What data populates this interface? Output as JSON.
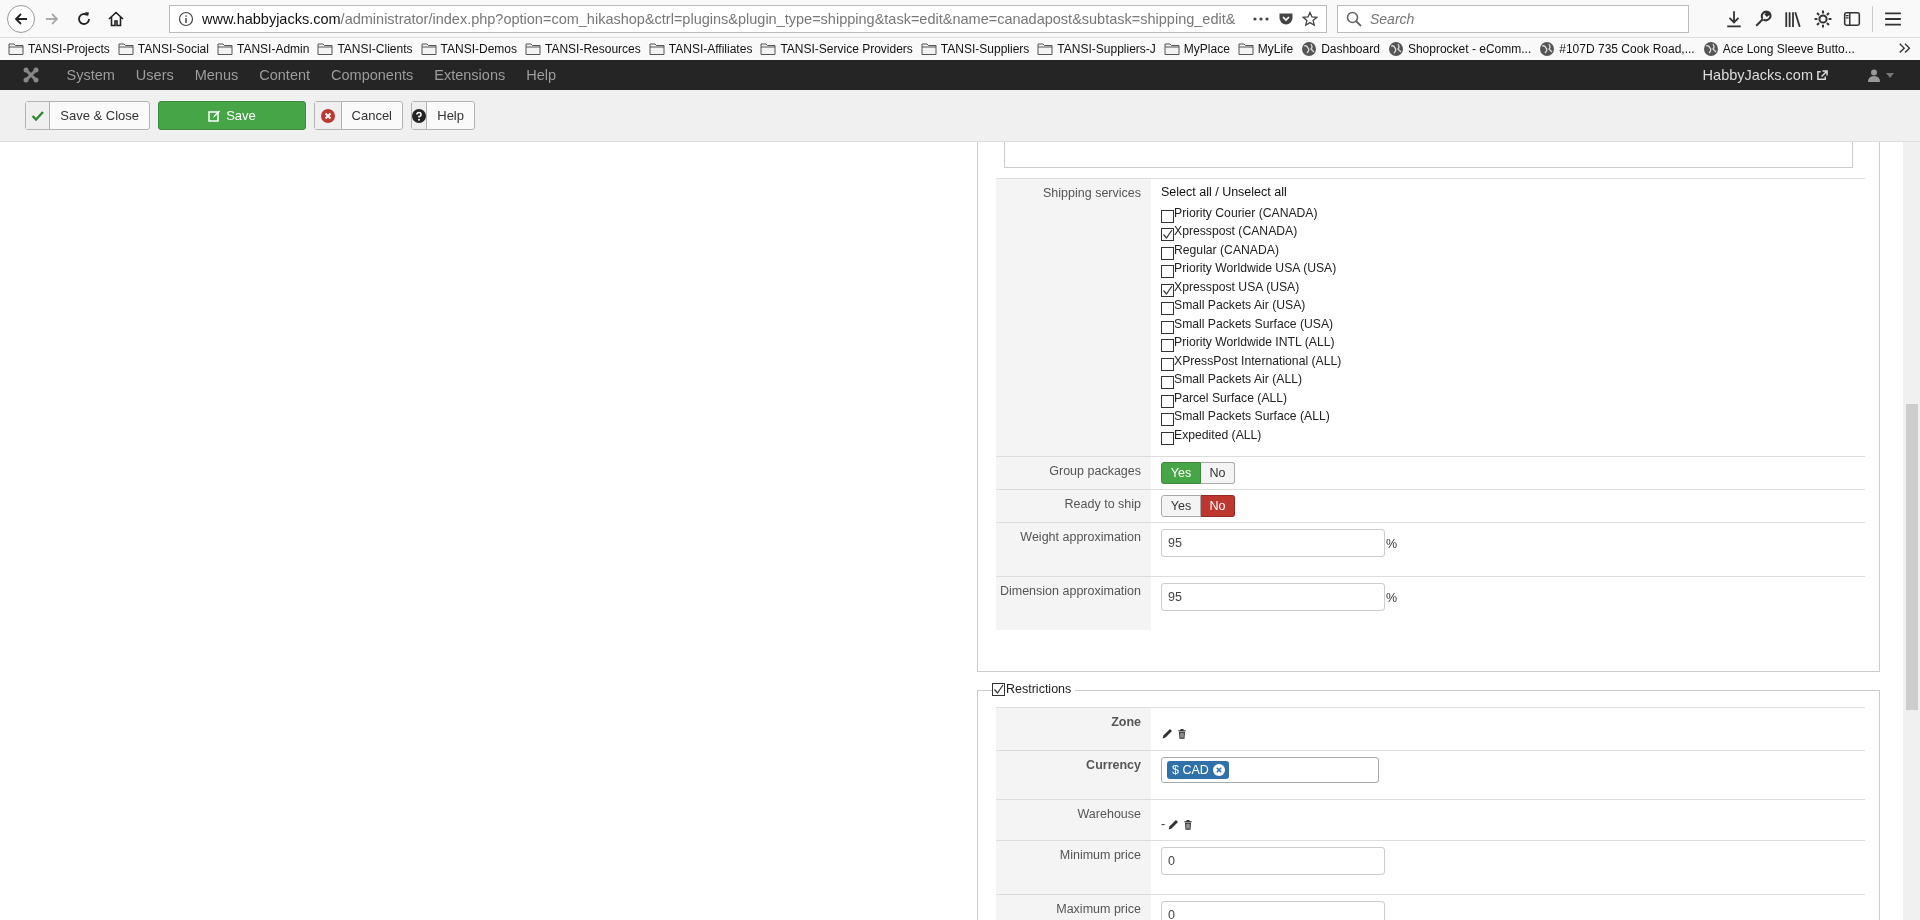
{
  "browser": {
    "url_domain": "www.habbyjacks.com",
    "url_path": "/administrator/index.php?option=com_hikashop&ctrl=plugins&plugin_type=shipping&task=edit&name=canadapost&subtask=shipping_edit&",
    "search": {
      "placeholder": "Search"
    },
    "bookmarks": [
      {
        "kind": "folder",
        "label": "TANSI-Projects"
      },
      {
        "kind": "folder",
        "label": "TANSI-Social"
      },
      {
        "kind": "folder",
        "label": "TANSI-Admin"
      },
      {
        "kind": "folder",
        "label": "TANSI-Clients"
      },
      {
        "kind": "folder",
        "label": "TANSI-Demos"
      },
      {
        "kind": "folder",
        "label": "TANSI-Resources"
      },
      {
        "kind": "folder",
        "label": "TANSI-Affiliates"
      },
      {
        "kind": "folder",
        "label": "TANSI-Service Providers"
      },
      {
        "kind": "folder",
        "label": "TANSI-Suppliers"
      },
      {
        "kind": "folder",
        "label": "TANSI-Suppliers-J"
      },
      {
        "kind": "folder",
        "label": "MyPlace"
      },
      {
        "kind": "folder",
        "label": "MyLife"
      },
      {
        "kind": "site",
        "label": "Dashboard"
      },
      {
        "kind": "site",
        "label": "Shoprocket - eComm..."
      },
      {
        "kind": "site",
        "label": "#107D 735 Cook Road,..."
      },
      {
        "kind": "site",
        "label": "Ace Long Sleeve Butto..."
      }
    ]
  },
  "admin_menu": {
    "items": [
      "System",
      "Users",
      "Menus",
      "Content",
      "Components",
      "Extensions",
      "Help"
    ],
    "site_link": "HabbyJacks.com"
  },
  "toolbar": [
    {
      "kind": "save-close",
      "label": "Save & Close"
    },
    {
      "kind": "save",
      "label": "Save"
    },
    {
      "kind": "cancel",
      "label": "Cancel"
    },
    {
      "kind": "help",
      "label": "Help"
    }
  ],
  "shipping_services": {
    "label": "Shipping services",
    "select_all": "Select all / Unselect all",
    "services": [
      {
        "label": "Priority Courier (CANADA)",
        "checked": false
      },
      {
        "label": "Xpresspost (CANADA)",
        "checked": true
      },
      {
        "label": "Regular (CANADA)",
        "checked": false
      },
      {
        "label": "Priority Worldwide USA (USA)",
        "checked": false
      },
      {
        "label": "Xpresspost USA (USA)",
        "checked": true
      },
      {
        "label": "Small Packets Air (USA)",
        "checked": false
      },
      {
        "label": "Small Packets Surface (USA)",
        "checked": false
      },
      {
        "label": "Priority Worldwide INTL (ALL)",
        "checked": false
      },
      {
        "label": "XPressPost International (ALL)",
        "checked": false
      },
      {
        "label": "Small Packets Air (ALL)",
        "checked": false
      },
      {
        "label": "Parcel Surface (ALL)",
        "checked": false
      },
      {
        "label": "Small Packets Surface (ALL)",
        "checked": false
      },
      {
        "label": "Expedited (ALL)",
        "checked": false
      }
    ]
  },
  "toggles": [
    {
      "label": "Group packages",
      "options": [
        {
          "kind": "yes",
          "label": "Yes",
          "selected": true
        },
        {
          "kind": "no",
          "label": "No",
          "selected": false
        }
      ]
    },
    {
      "label": "Ready to ship",
      "options": [
        {
          "kind": "yes",
          "label": "Yes",
          "selected": false
        },
        {
          "kind": "no",
          "label": "No",
          "selected": true
        }
      ]
    }
  ],
  "approximations": [
    {
      "label": "Weight approximation",
      "value": "95",
      "unit": "%"
    },
    {
      "label": "Dimension approximation",
      "value": "95",
      "unit": "%"
    }
  ],
  "restrictions": {
    "legend": "Restrictions",
    "checked": true,
    "rows": [
      {
        "kind": "icons",
        "label": "Zone",
        "emphasized": true
      },
      {
        "kind": "tags",
        "label": "Currency",
        "emphasized": true,
        "tags": [
          "$ CAD"
        ]
      },
      {
        "kind": "icons",
        "label": "Warehouse",
        "emphasized": false,
        "value": "-"
      },
      {
        "kind": "input",
        "label": "Minimum price",
        "emphasized": false,
        "value": "0"
      },
      {
        "kind": "input",
        "label": "Maximum price",
        "emphasized": false,
        "value": "0"
      }
    ]
  }
}
